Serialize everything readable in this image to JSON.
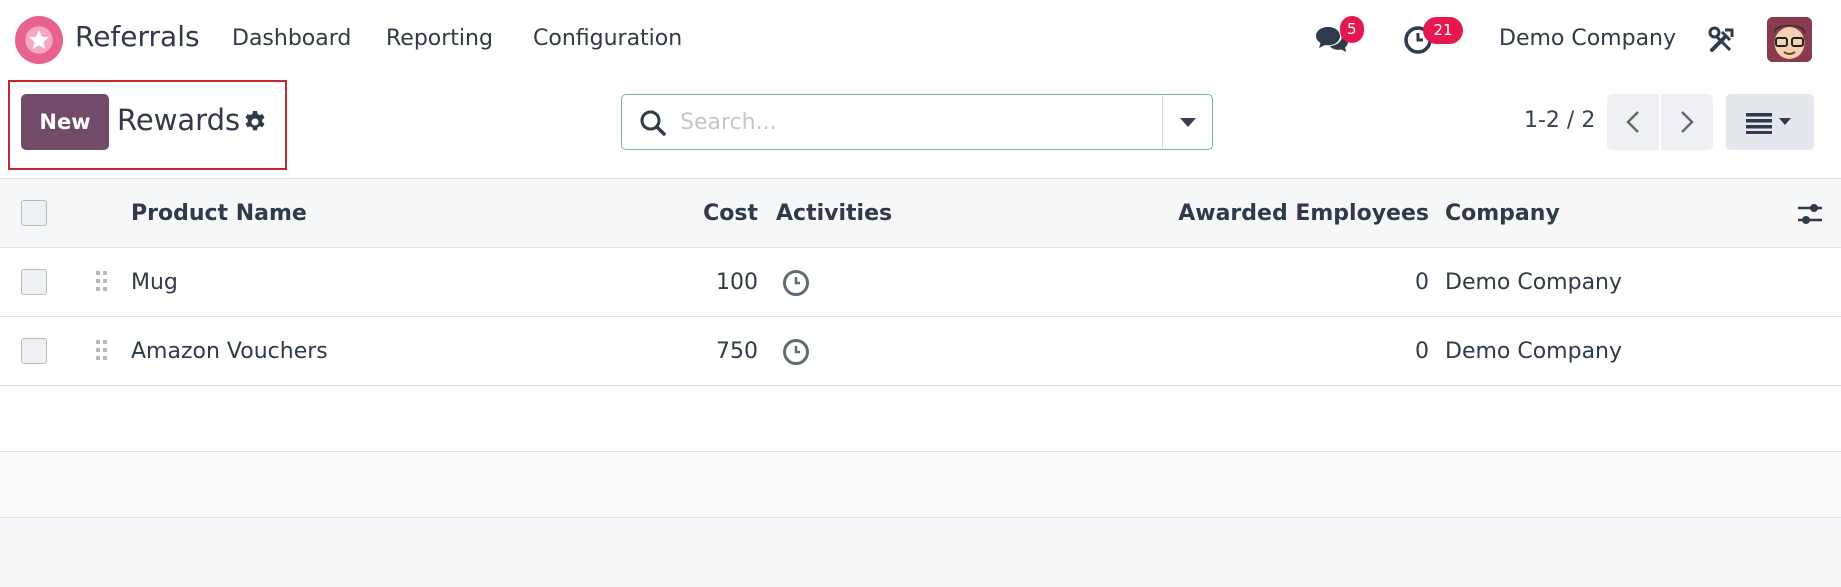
{
  "navbar": {
    "app_name": "Referrals",
    "menu": [
      "Dashboard",
      "Reporting",
      "Configuration"
    ],
    "messages_badge": "5",
    "activities_badge": "21",
    "company": "Demo Company"
  },
  "control_panel": {
    "new_label": "New",
    "title": "Rewards",
    "search_placeholder": "Search...",
    "pager": "1-2 / 2"
  },
  "list": {
    "columns": [
      "Product Name",
      "Cost",
      "Activities",
      "Awarded Employees",
      "Company"
    ],
    "rows": [
      {
        "product_name": "Mug",
        "cost": "100",
        "awarded_employees": "0",
        "company": "Demo Company"
      },
      {
        "product_name": "Amazon Vouchers",
        "cost": "750",
        "awarded_employees": "0",
        "company": "Demo Company"
      }
    ]
  },
  "colors": {
    "brand": "#714b67",
    "badge": "#e5194f",
    "highlight": "#c6262e"
  },
  "icons": [
    "app-logo-icon",
    "chat-icon",
    "clock-icon",
    "tools-icon",
    "gear-icon",
    "search-icon",
    "caret-down-icon",
    "chevron-left-icon",
    "chevron-right-icon",
    "list-view-icon",
    "optional-columns-icon",
    "drag-handle-icon",
    "activity-clock-icon"
  ]
}
